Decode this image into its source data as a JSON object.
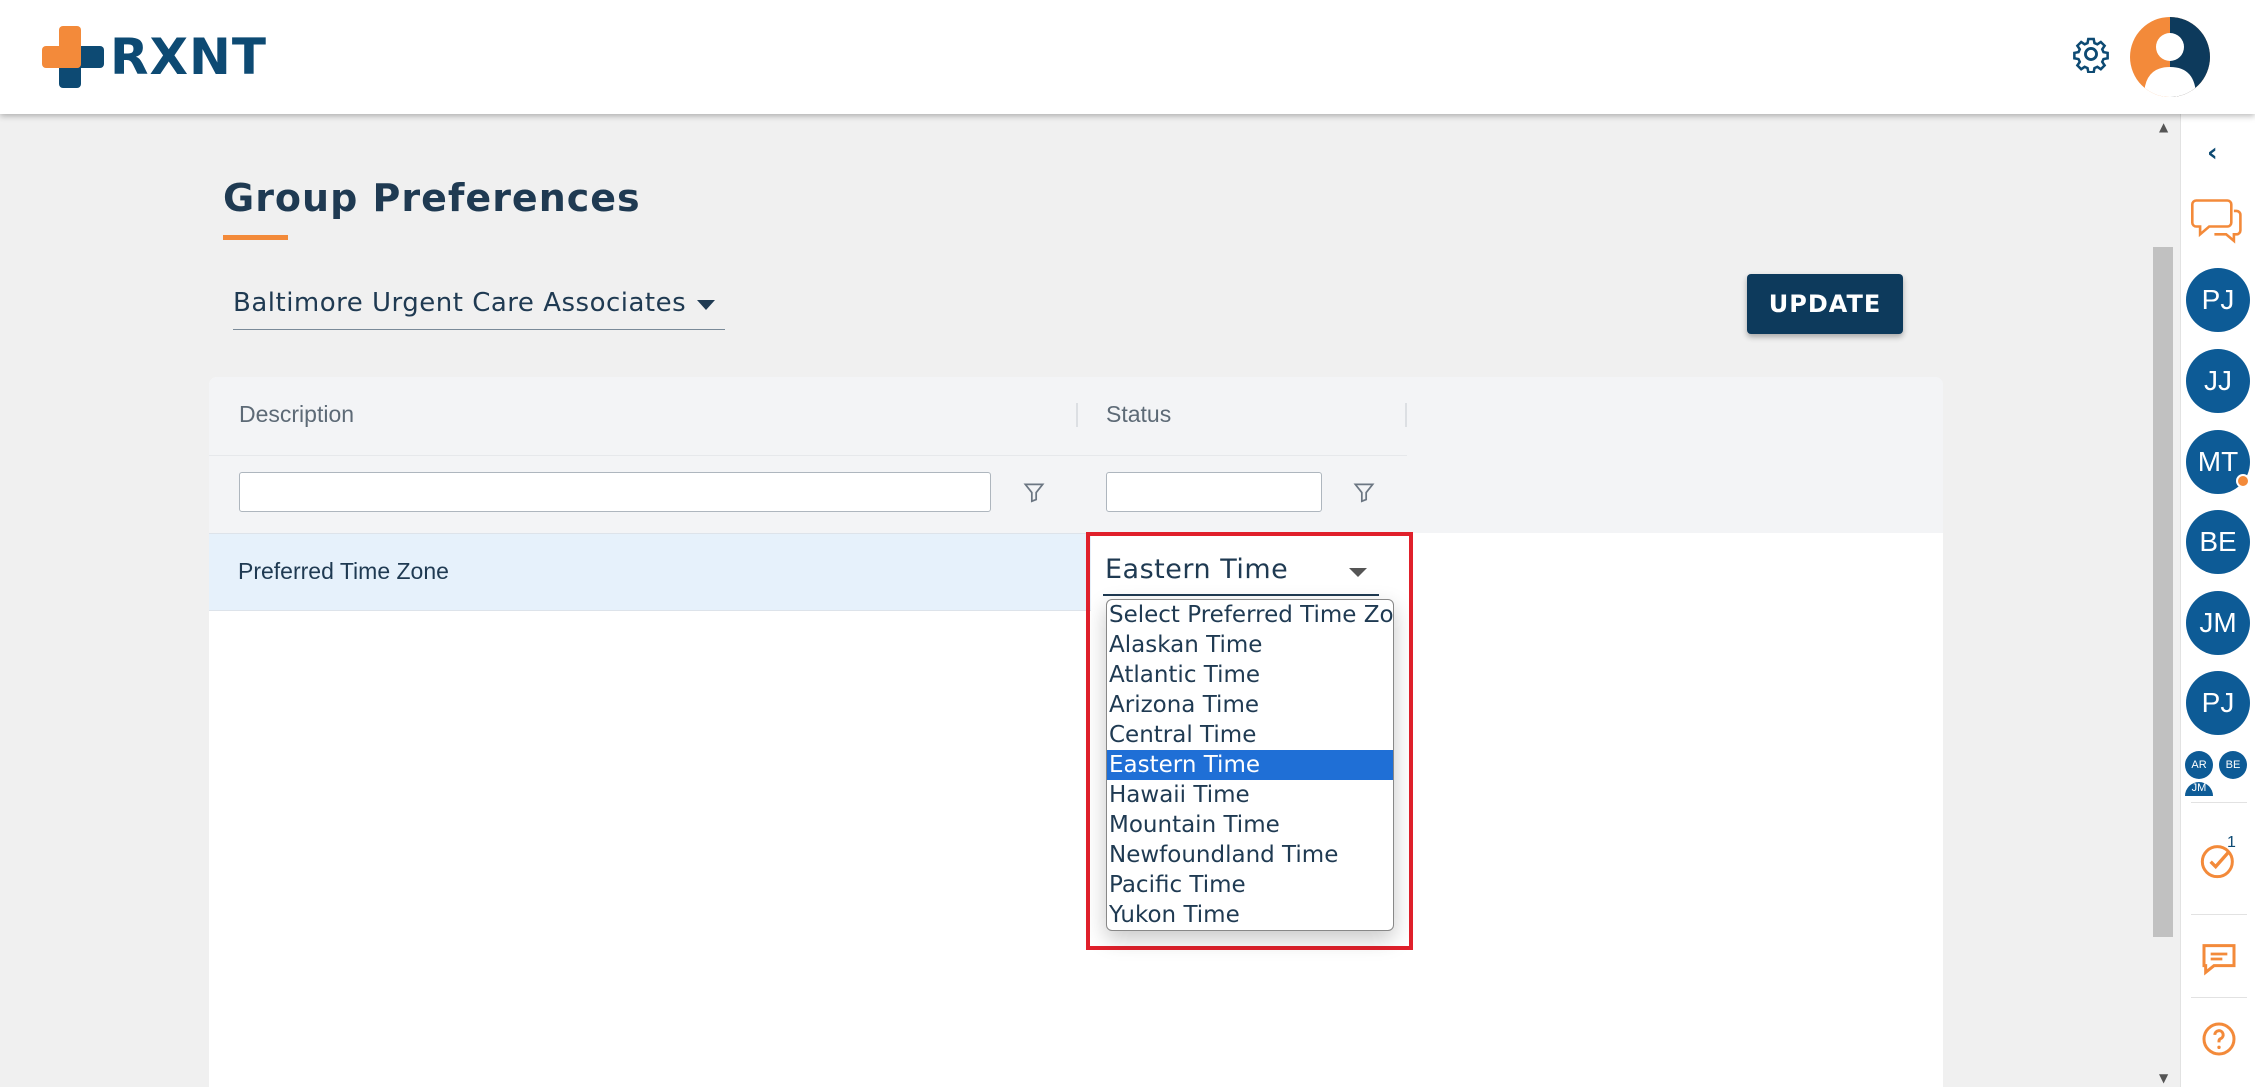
{
  "header": {
    "logo_text": "RXNT",
    "settings_icon": "gear-icon",
    "user_avatar_icon": "user-avatar-icon"
  },
  "page": {
    "title": "Group Preferences",
    "group_select_value": "Baltimore Urgent Care Associates",
    "update_label": "UPDATE"
  },
  "grid": {
    "columns": [
      "Description",
      "Status"
    ],
    "description_filter": "",
    "status_filter": "",
    "rows": [
      {
        "description": "Preferred Time Zone",
        "status": "Eastern Time"
      }
    ]
  },
  "status_dropdown": {
    "selected": "Eastern Time",
    "options": [
      "Select Preferred Time Zone",
      "Alaskan Time",
      "Atlantic Time",
      "Arizona Time",
      "Central Time",
      "Eastern Time",
      "Hawaii Time",
      "Mountain Time",
      "Newfoundland Time",
      "Pacific Time",
      "Yukon Time"
    ]
  },
  "rail": {
    "collapse_icon": "chevron-left-icon",
    "chat_icon": "chat-bubbles-icon",
    "people": [
      "PJ",
      "JJ",
      "MT",
      "BE",
      "JM",
      "PJ"
    ],
    "mini_people": [
      "AR",
      "BE",
      "JM"
    ],
    "task_badge": "1",
    "tools": [
      "tasks-check-icon",
      "message-icon",
      "help-icon"
    ]
  },
  "colors": {
    "brand_navy": "#0d4a73",
    "brand_orange": "#f38a3a",
    "button_navy": "#0d3a5c",
    "selected_option": "#1f6fd6",
    "highlight_red": "#e0202b",
    "row_highlight": "#e6f1fb"
  }
}
